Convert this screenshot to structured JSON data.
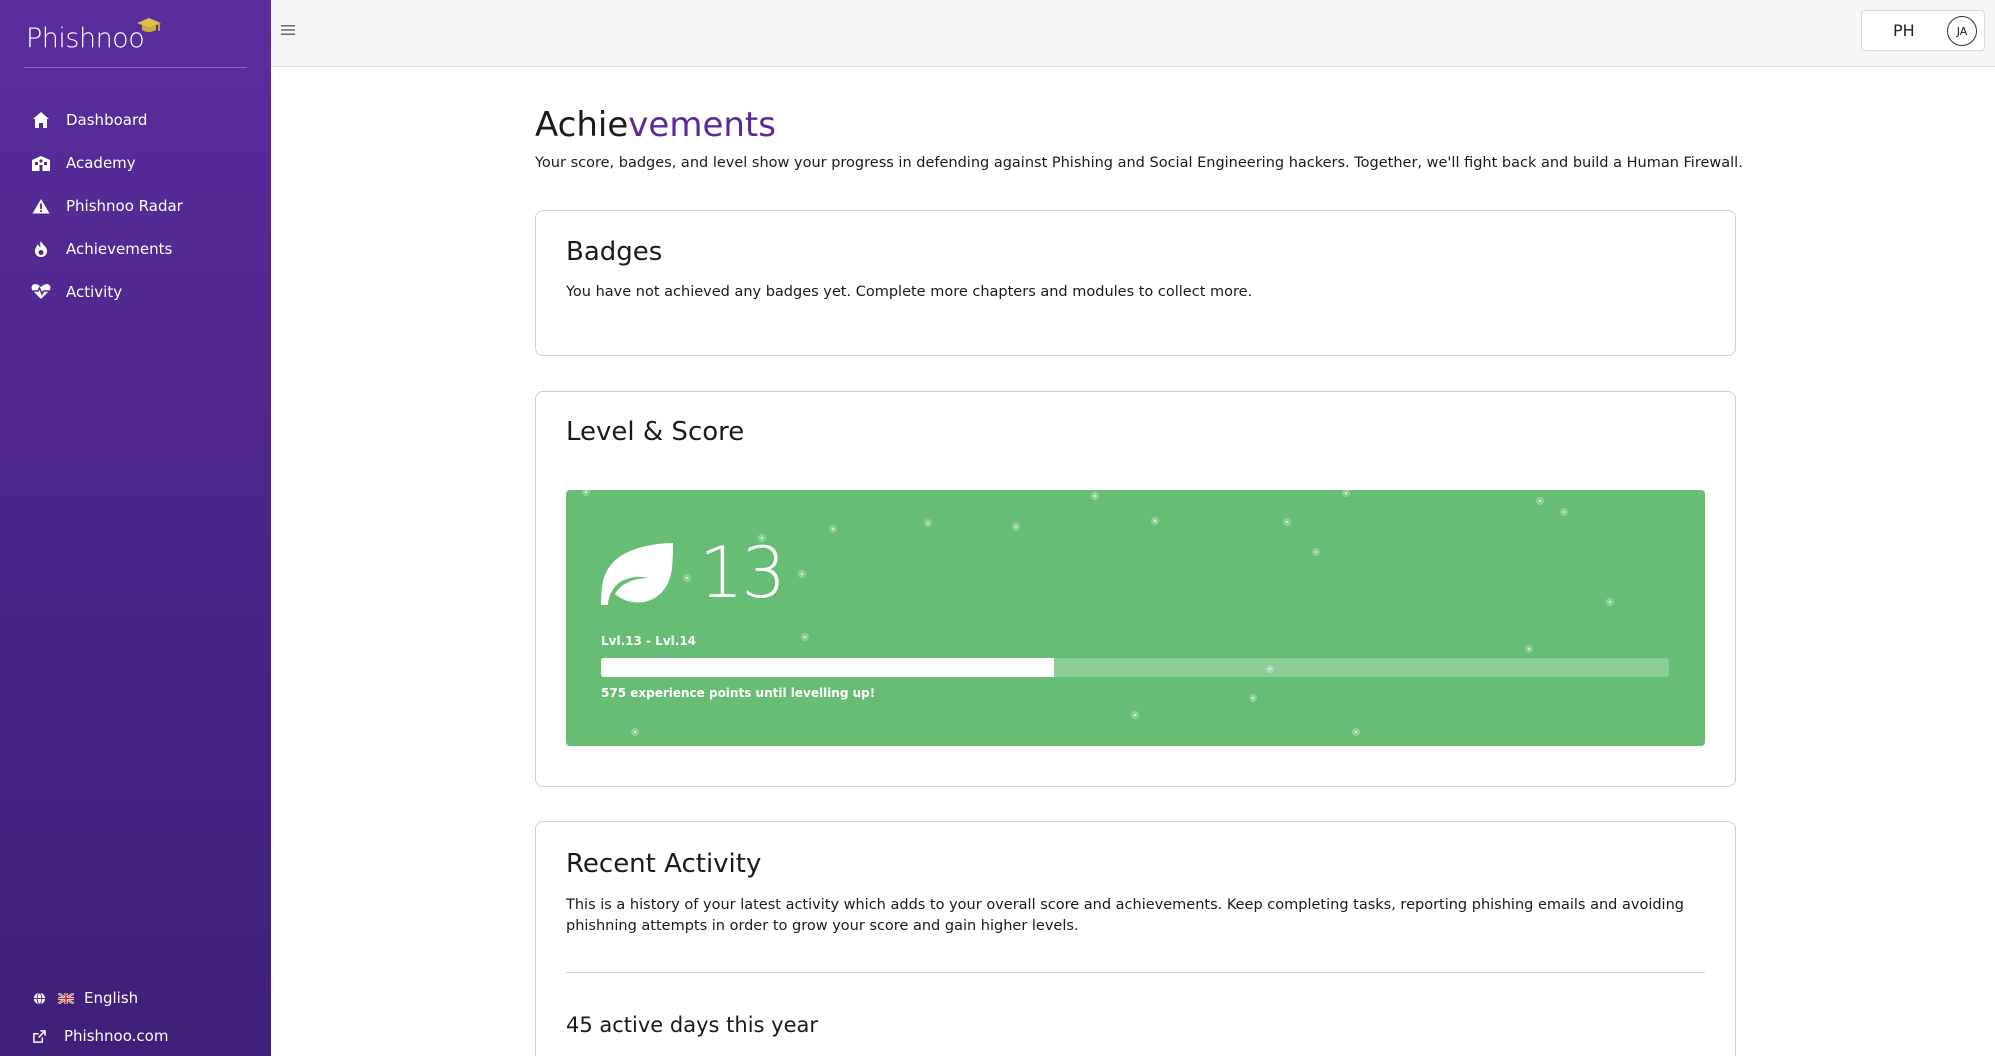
{
  "brand": {
    "logo_text": "Phishnoo"
  },
  "sidebar": {
    "items": [
      {
        "label": "Dashboard",
        "icon": "home-icon"
      },
      {
        "label": "Academy",
        "icon": "school-icon"
      },
      {
        "label": "Phishnoo Radar",
        "icon": "warning-icon"
      },
      {
        "label": "Achievements",
        "icon": "flame-icon"
      },
      {
        "label": "Activity",
        "icon": "heartbeat-icon"
      }
    ],
    "language": {
      "label": "English",
      "icon": "globe-icon",
      "flag": "uk-flag"
    },
    "external_link": {
      "label": "Phishnoo.com",
      "icon": "external-link-icon"
    }
  },
  "topbar": {
    "menu_icon": "hamburger-icon",
    "user_initials": "PH",
    "avatar_initials": "JA"
  },
  "page": {
    "title_part1": "Achie",
    "title_part2": "vements",
    "subtitle": "Your score, badges, and level show your progress in defending against Phishing and Social Engineering hackers. Together, we'll fight back and build a Human Firewall."
  },
  "badges": {
    "title": "Badges",
    "text": "You have not achieved any badges yet. Complete more chapters and modules to collect more."
  },
  "level": {
    "title": "Level & Score",
    "current_level": "13",
    "range_label": "Lvl.13 - Lvl.14",
    "progress_fraction": 0.424,
    "xp_text": "575 experience points until levelling up!"
  },
  "activity": {
    "title": "Recent Activity",
    "text": "This is a history of your latest activity which adds to your overall score and achievements. Keep completing tasks, reporting phishing emails and avoiding phishning attempts in order to grow your score and gain higher levels.",
    "active_days": "45 active days this year"
  },
  "colors": {
    "sidebar": "#4e2690",
    "accent": "#5b2a9a",
    "level_banner": "#67bd74",
    "logo_gold": "#d9c14a"
  }
}
